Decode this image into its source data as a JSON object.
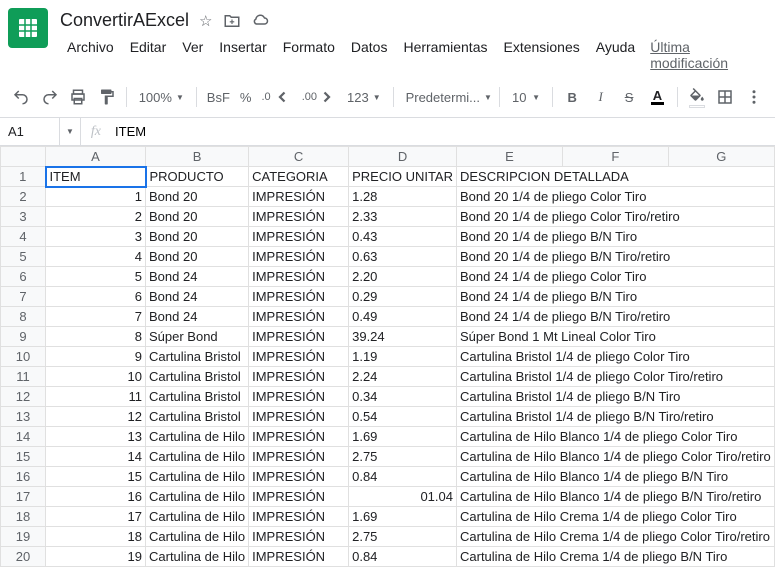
{
  "doc": {
    "title": "ConvertirAExcel"
  },
  "menus": [
    "Archivo",
    "Editar",
    "Ver",
    "Insertar",
    "Formato",
    "Datos",
    "Herramientas",
    "Extensiones",
    "Ayuda"
  ],
  "lastEdit": "Última modificación",
  "toolbar": {
    "zoom": "100%",
    "currency": "BsF",
    "percent": "%",
    "decDec": ".0",
    "incDec": ".00",
    "numFmt": "123",
    "font": "Predetermi...",
    "fontSize": "10"
  },
  "nameBox": "A1",
  "formulaBar": "ITEM",
  "columns": [
    "A",
    "B",
    "C",
    "D",
    "E",
    "F",
    "G"
  ],
  "headers": [
    "ITEM",
    "PRODUCTO",
    "CATEGORIA",
    "PRECIO UNITARIO",
    "DESCRIPCION DETALLADA"
  ],
  "rows": [
    {
      "n": 1,
      "item": "1",
      "prod": "Bond 20",
      "cat": "IMPRESIÓN",
      "precio": "1.28",
      "desc": "Bond 20 1/4 de pliego Color Tiro"
    },
    {
      "n": 2,
      "item": "2",
      "prod": "Bond 20",
      "cat": "IMPRESIÓN",
      "precio": "2.33",
      "desc": "Bond 20 1/4 de pliego Color Tiro/retiro"
    },
    {
      "n": 3,
      "item": "3",
      "prod": "Bond 20",
      "cat": "IMPRESIÓN",
      "precio": "0.43",
      "desc": "Bond 20 1/4 de pliego B/N Tiro"
    },
    {
      "n": 4,
      "item": "4",
      "prod": "Bond 20",
      "cat": "IMPRESIÓN",
      "precio": "0.63",
      "desc": "Bond 20 1/4 de pliego B/N Tiro/retiro"
    },
    {
      "n": 5,
      "item": "5",
      "prod": "Bond 24",
      "cat": "IMPRESIÓN",
      "precio": "2.20",
      "desc": "Bond 24 1/4 de pliego Color Tiro"
    },
    {
      "n": 6,
      "item": "6",
      "prod": "Bond 24",
      "cat": "IMPRESIÓN",
      "precio": "0.29",
      "desc": "Bond 24 1/4 de pliego B/N Tiro"
    },
    {
      "n": 7,
      "item": "7",
      "prod": "Bond 24",
      "cat": "IMPRESIÓN",
      "precio": "0.49",
      "desc": "Bond 24 1/4 de pliego B/N Tiro/retiro"
    },
    {
      "n": 8,
      "item": "8",
      "prod": "Súper Bond",
      "cat": "IMPRESIÓN",
      "precio": "39.24",
      "desc": "Súper Bond 1 Mt Lineal Color Tiro"
    },
    {
      "n": 9,
      "item": "9",
      "prod": "Cartulina Bristol",
      "cat": "IMPRESIÓN",
      "precio": "1.19",
      "desc": "Cartulina Bristol 1/4 de pliego Color Tiro"
    },
    {
      "n": 10,
      "item": "10",
      "prod": "Cartulina Bristol",
      "cat": "IMPRESIÓN",
      "precio": "2.24",
      "desc": "Cartulina Bristol 1/4 de pliego Color Tiro/retiro"
    },
    {
      "n": 11,
      "item": "11",
      "prod": "Cartulina Bristol",
      "cat": "IMPRESIÓN",
      "precio": "0.34",
      "desc": "Cartulina Bristol 1/4 de pliego B/N Tiro"
    },
    {
      "n": 12,
      "item": "12",
      "prod": "Cartulina Bristol",
      "cat": "IMPRESIÓN",
      "precio": "0.54",
      "desc": "Cartulina Bristol 1/4 de pliego B/N Tiro/retiro"
    },
    {
      "n": 13,
      "item": "13",
      "prod": "Cartulina de Hilo",
      "cat": "IMPRESIÓN",
      "precio": "1.69",
      "desc": "Cartulina de Hilo Blanco 1/4 de pliego Color Tiro"
    },
    {
      "n": 14,
      "item": "14",
      "prod": "Cartulina de Hilo",
      "cat": "IMPRESIÓN",
      "precio": "2.75",
      "desc": "Cartulina de Hilo Blanco 1/4 de pliego Color Tiro/retiro"
    },
    {
      "n": 15,
      "item": "15",
      "prod": "Cartulina de Hilo",
      "cat": "IMPRESIÓN",
      "precio": "0.84",
      "desc": "Cartulina de Hilo Blanco 1/4 de pliego B/N Tiro"
    },
    {
      "n": 16,
      "item": "16",
      "prod": "Cartulina de Hilo",
      "cat": "IMPRESIÓN",
      "precio": "",
      "precioRight": "01.04",
      "desc": "Cartulina de Hilo Blanco 1/4 de pliego B/N Tiro/retiro"
    },
    {
      "n": 17,
      "item": "17",
      "prod": "Cartulina de Hilo",
      "cat": "IMPRESIÓN",
      "precio": "1.69",
      "desc": "Cartulina de Hilo Crema 1/4 de pliego Color Tiro"
    },
    {
      "n": 18,
      "item": "18",
      "prod": "Cartulina de Hilo",
      "cat": "IMPRESIÓN",
      "precio": "2.75",
      "desc": "Cartulina de Hilo Crema 1/4 de pliego Color Tiro/retiro"
    },
    {
      "n": 19,
      "item": "19",
      "prod": "Cartulina de Hilo",
      "cat": "IMPRESIÓN",
      "precio": "0.84",
      "desc": "Cartulina de Hilo Crema 1/4 de pliego B/N Tiro"
    }
  ]
}
